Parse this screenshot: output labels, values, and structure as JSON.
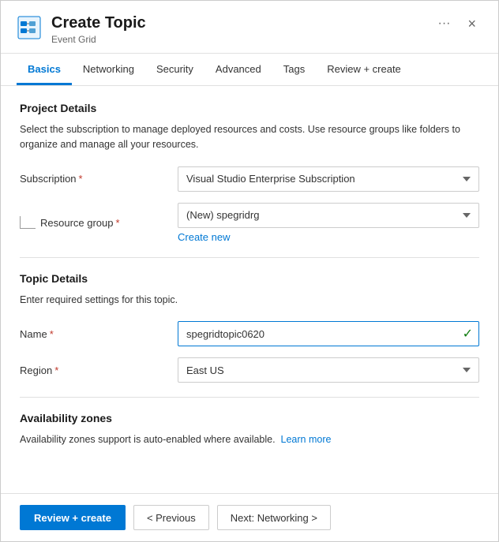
{
  "dialog": {
    "title": "Create Topic",
    "subtitle": "Event Grid",
    "icon_label": "event-grid-icon",
    "close_label": "×",
    "ellipsis_label": "···"
  },
  "tabs": [
    {
      "id": "basics",
      "label": "Basics",
      "active": true
    },
    {
      "id": "networking",
      "label": "Networking",
      "active": false
    },
    {
      "id": "security",
      "label": "Security",
      "active": false
    },
    {
      "id": "advanced",
      "label": "Advanced",
      "active": false
    },
    {
      "id": "tags",
      "label": "Tags",
      "active": false
    },
    {
      "id": "review-create",
      "label": "Review + create",
      "active": false
    }
  ],
  "sections": {
    "project_details": {
      "title": "Project Details",
      "description": "Select the subscription to manage deployed resources and costs. Use resource groups like folders to organize and manage all your resources.",
      "subscription_label": "Subscription",
      "subscription_required": "*",
      "subscription_value": "Visual Studio Enterprise Subscription",
      "resource_group_label": "Resource group",
      "resource_group_required": "*",
      "resource_group_value": "(New) spegridrg",
      "create_new_label": "Create new"
    },
    "topic_details": {
      "title": "Topic Details",
      "description": "Enter required settings for this topic.",
      "name_label": "Name",
      "name_required": "*",
      "name_value": "spegridtopic0620",
      "region_label": "Region",
      "region_required": "*",
      "region_value": "East US"
    },
    "availability_zones": {
      "title": "Availability zones",
      "description": "Availability zones support is auto-enabled where available.",
      "learn_more_label": "Learn more"
    }
  },
  "footer": {
    "review_create_label": "Review + create",
    "previous_label": "< Previous",
    "next_label": "Next: Networking >"
  },
  "colors": {
    "primary": "#0078d4",
    "required": "#c0392b",
    "success": "#107c10"
  }
}
